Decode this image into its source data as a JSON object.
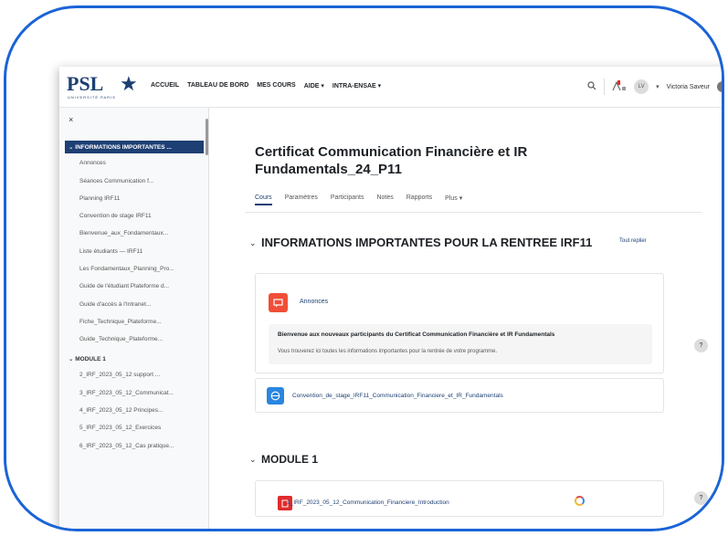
{
  "header": {
    "logo_text": "PSL",
    "logo_star": "★",
    "logo_sub": "UNIVERSITÉ PARIS",
    "nav": [
      "ACCUEIL",
      "TABLEAU DE BORD",
      "MES COURS",
      "AIDE ▾",
      "INTRA-ENSAE ▾"
    ],
    "search_icon": "search-icon",
    "notif_icon": "bell-icon",
    "avatar_initials": "LV",
    "user_name": "Victoria Saveur",
    "caret": "▾"
  },
  "sidebar": {
    "close_label": "×",
    "sections": [
      {
        "label": "INFORMATIONS IMPORTANTES ...",
        "active": true,
        "items": [
          "Annonces",
          "Séances Communication f...",
          "Planning IRF11",
          "Convention de stage IRF11",
          "Bienvenue_aux_Fondamentaux...",
          "Liste étudiants — IRF11",
          "Les Fondamentaux_Planning_Pro...",
          "Guide de l'étudiant Plateforme d...",
          "Guide d'accès à l'Intranet...",
          "Fiche_Technique_Plateforme...",
          "Guide_Technique_Plateforme..."
        ]
      },
      {
        "label": "MODULE 1",
        "active": false,
        "items": [
          "2_IRF_2023_05_12 support ...",
          "3_IRF_2023_05_12_Communicat...",
          "4_IRF_2023_05_12 Principes...",
          "5_IRF_2023_05_12_Exercices",
          "6_IRF_2023_05_12_Cas pratique..."
        ]
      }
    ]
  },
  "main": {
    "course_title": "Certificat Communication Financière et IR Fundamentals_24_P11",
    "tabs": [
      "Cours",
      "Paramètres",
      "Participants",
      "Notes",
      "Rapports",
      "Plus ▾"
    ],
    "section1": {
      "title": "INFORMATIONS IMPORTANTES POUR LA RENTREE IRF11",
      "collapse_all": "Tout replier",
      "forum_label": "Annonces",
      "notice_bold": "Bienvenue aux nouveaux participants du Certificat Communication Financière et IR Fundamentals",
      "notice_text": "Vous trouverez ici toutes les informations importantes pour la rentrée de votre programme.",
      "url_label": "Convention_de_stage_IRF11_Communication_Financiere_et_IR_Fundamentals"
    },
    "section2": {
      "title": "MODULE 1",
      "pdf_label": "1_IRF_2023_05_12_Communication_Financiere_Introduction"
    },
    "help": "?"
  }
}
